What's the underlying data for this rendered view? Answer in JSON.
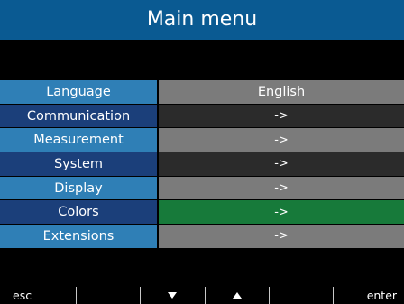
{
  "title": "Main menu",
  "menu": [
    {
      "label": "Language",
      "value": "English"
    },
    {
      "label": "Communication",
      "value": "->"
    },
    {
      "label": "Measurement",
      "value": "->"
    },
    {
      "label": "System",
      "value": "->"
    },
    {
      "label": "Display",
      "value": "->"
    },
    {
      "label": "Colors",
      "value": "->"
    },
    {
      "label": "Extensions",
      "value": "->"
    }
  ],
  "softkeys": {
    "esc": "esc",
    "down_icon": "down-arrow-icon",
    "up_icon": "up-arrow-icon",
    "enter": "enter"
  },
  "colors": {
    "title_bar": "#0a5a92",
    "label_light": "#2f7fb6",
    "label_dark": "#1b3f7a",
    "value_grey": "#7b7b7b",
    "value_black": "#2b2b2b",
    "selected": "#177a3a"
  }
}
